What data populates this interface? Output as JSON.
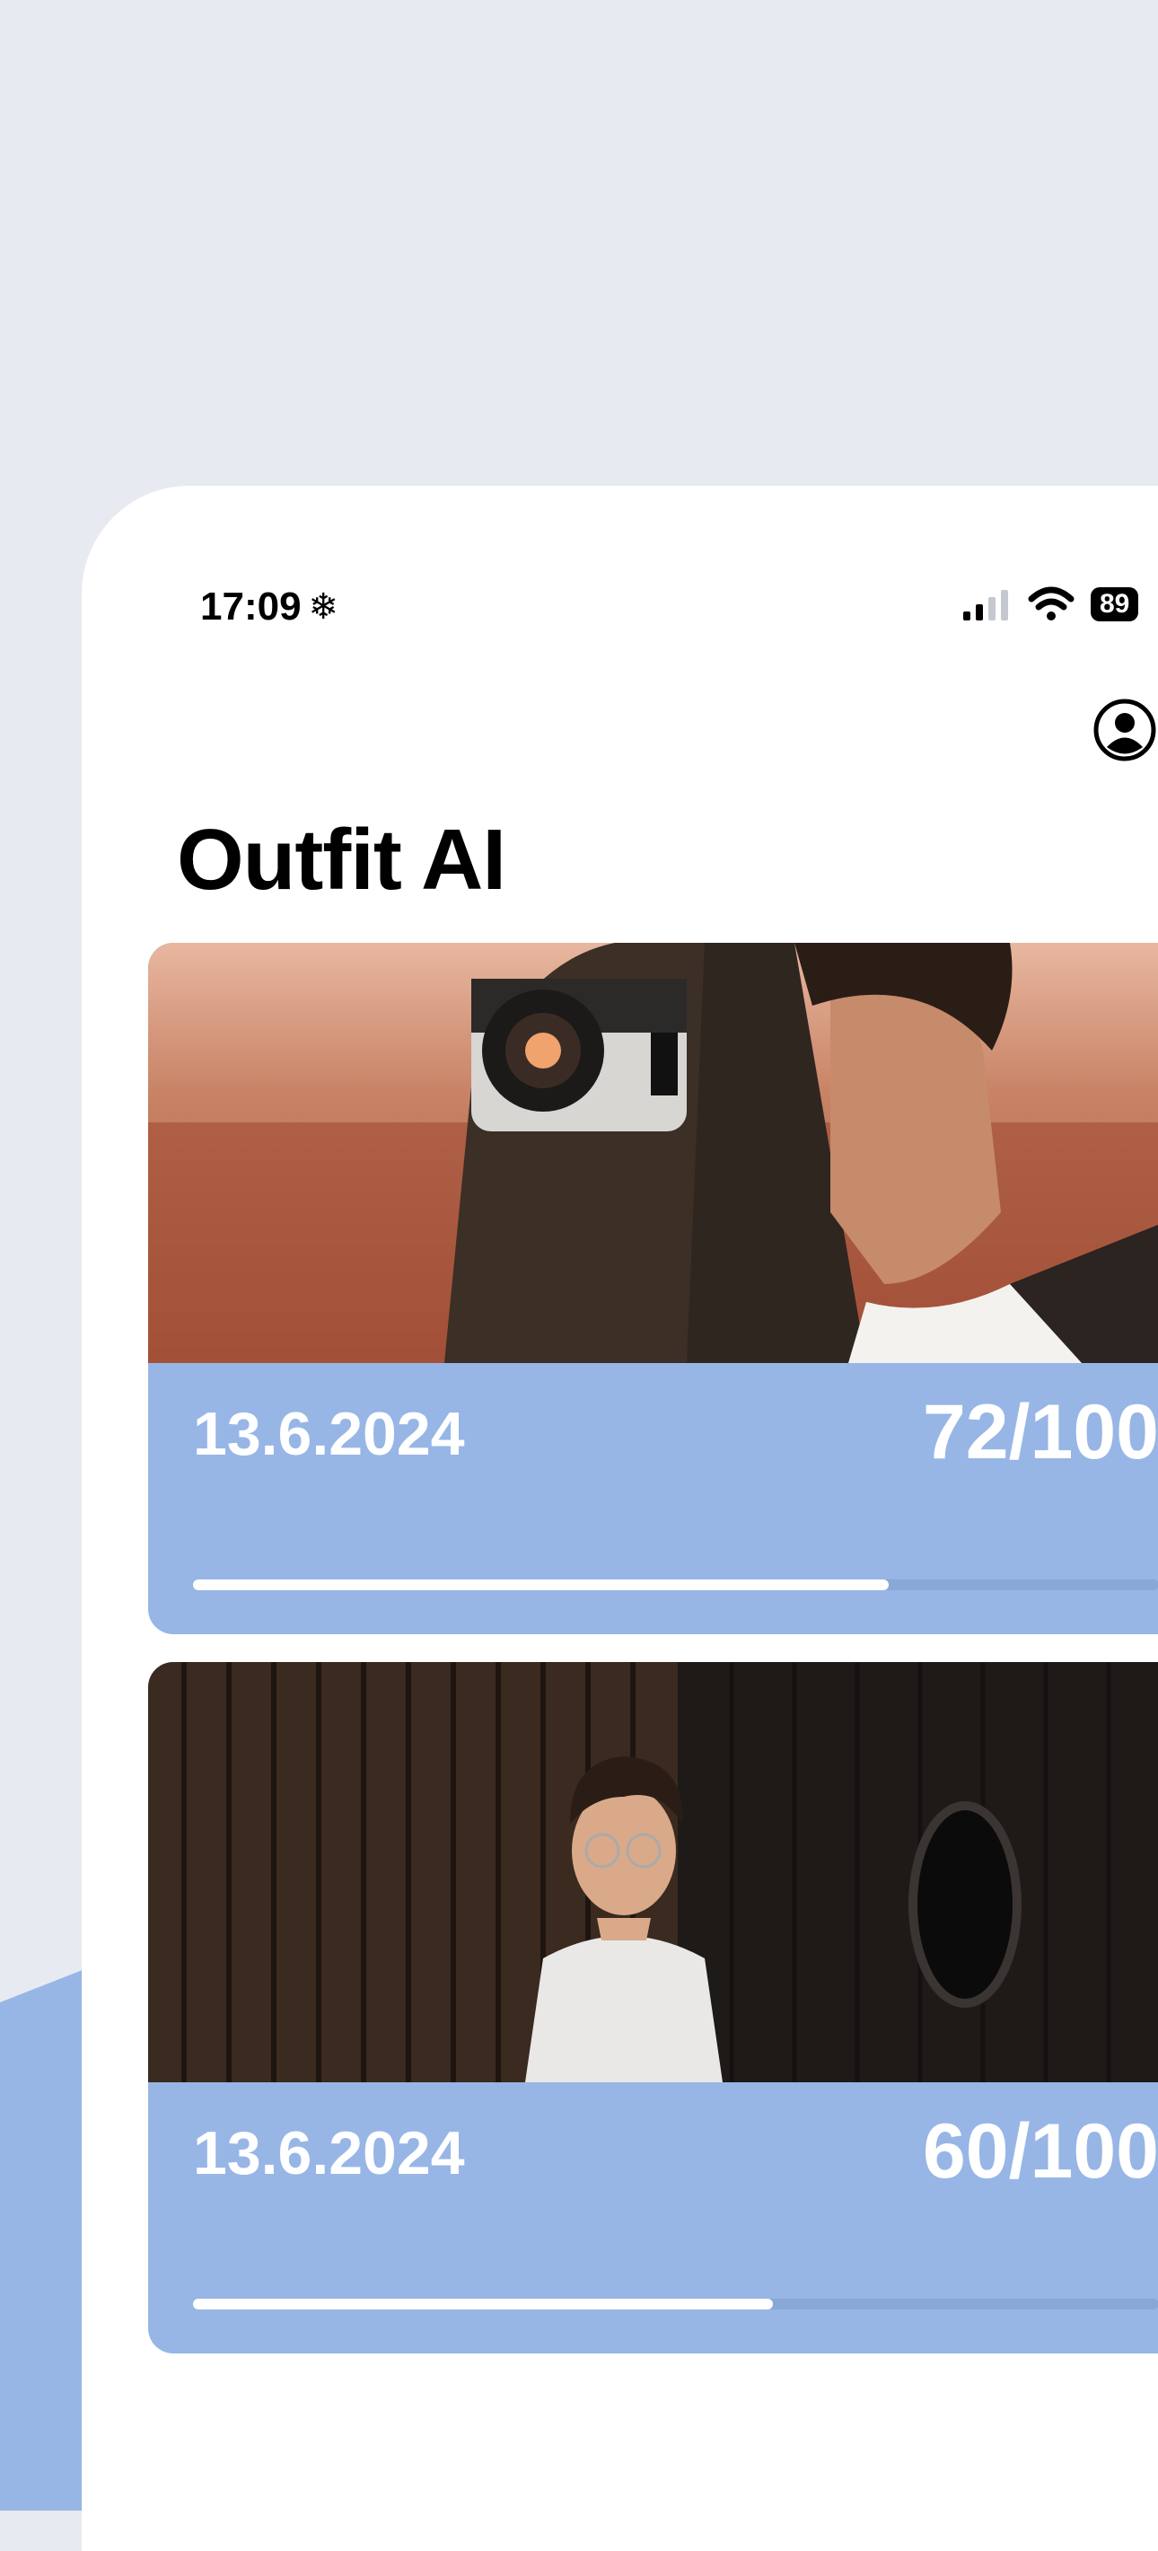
{
  "status_bar": {
    "time": "17:09",
    "battery": "89"
  },
  "header": {
    "title": "Outfit AI"
  },
  "cards": [
    {
      "date": "13.6.2024",
      "score": "72/100",
      "progress": 0.72
    },
    {
      "date": "13.6.2024",
      "score": "60/100",
      "progress": 0.6
    }
  ],
  "colors": {
    "accent": "#97b6e6",
    "background": "#e7eaf0"
  },
  "icons": {
    "status": [
      "snowflake-icon",
      "cellular-signal-icon",
      "wifi-icon",
      "battery-icon"
    ],
    "header": "profile-icon"
  }
}
